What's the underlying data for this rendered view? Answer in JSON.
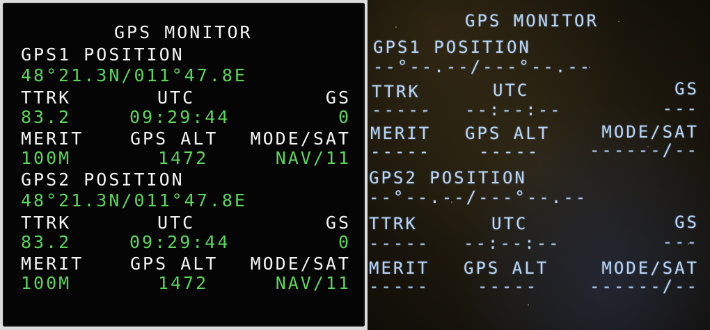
{
  "left_display": {
    "title": "GPS MONITOR",
    "gps1": {
      "section": "GPS1 POSITION",
      "position": "48°21.3N/011°47.8E",
      "ttrk_label": "TTRK",
      "utc_label": "UTC",
      "gs_label": "GS",
      "ttrk_value": "83.2",
      "utc_value": "09:29:44",
      "gs_value": "0",
      "merit_label": "MERIT",
      "alt_label": "GPS ALT",
      "mode_label": "MODE/SAT",
      "merit_value": "100M",
      "alt_value": "1472",
      "mode_value": "NAV/11"
    },
    "gps2": {
      "section": "GPS2 POSITION",
      "position": "48°21.3N/011°47.8E",
      "ttrk_label": "TTRK",
      "utc_label": "UTC",
      "gs_label": "GS",
      "ttrk_value": "83.2",
      "utc_value": "09:29:44",
      "gs_value": "0",
      "merit_label": "MERIT",
      "alt_label": "GPS ALT",
      "mode_label": "MODE/SAT",
      "merit_value": "100M",
      "alt_value": "1472",
      "mode_value": "NAV/11"
    }
  },
  "right_display": {
    "title": "GPS MONITOR",
    "gps1": {
      "section": "GPS1 POSITION",
      "position": "--°--.--/---°--.--",
      "ttrk_label": "TTRK",
      "utc_label": "UTC",
      "gs_label": "GS",
      "ttrk_value": "-----",
      "utc_value": "--:--:--",
      "gs_value": "---",
      "merit_label": "MERIT",
      "alt_label": "GPS ALT",
      "mode_label": "MODE/SAT",
      "merit_value": "-----",
      "alt_value": "-----",
      "mode_value": "------/--"
    },
    "gps2": {
      "section": "GPS2 POSITION",
      "position": "--°--.--/---°--.--",
      "ttrk_label": "TTRK",
      "utc_label": "UTC",
      "gs_label": "GS",
      "ttrk_value": "-----",
      "utc_value": "--:--:--",
      "gs_value": "---",
      "merit_label": "MERIT",
      "alt_label": "GPS ALT",
      "mode_label": "MODE/SAT",
      "merit_value": "-----",
      "alt_value": "-----",
      "mode_value": "------/--"
    }
  },
  "colors": {
    "label": "#f4f4f4",
    "value": "#5bd65b",
    "photo_text": "#b9d4f3"
  }
}
